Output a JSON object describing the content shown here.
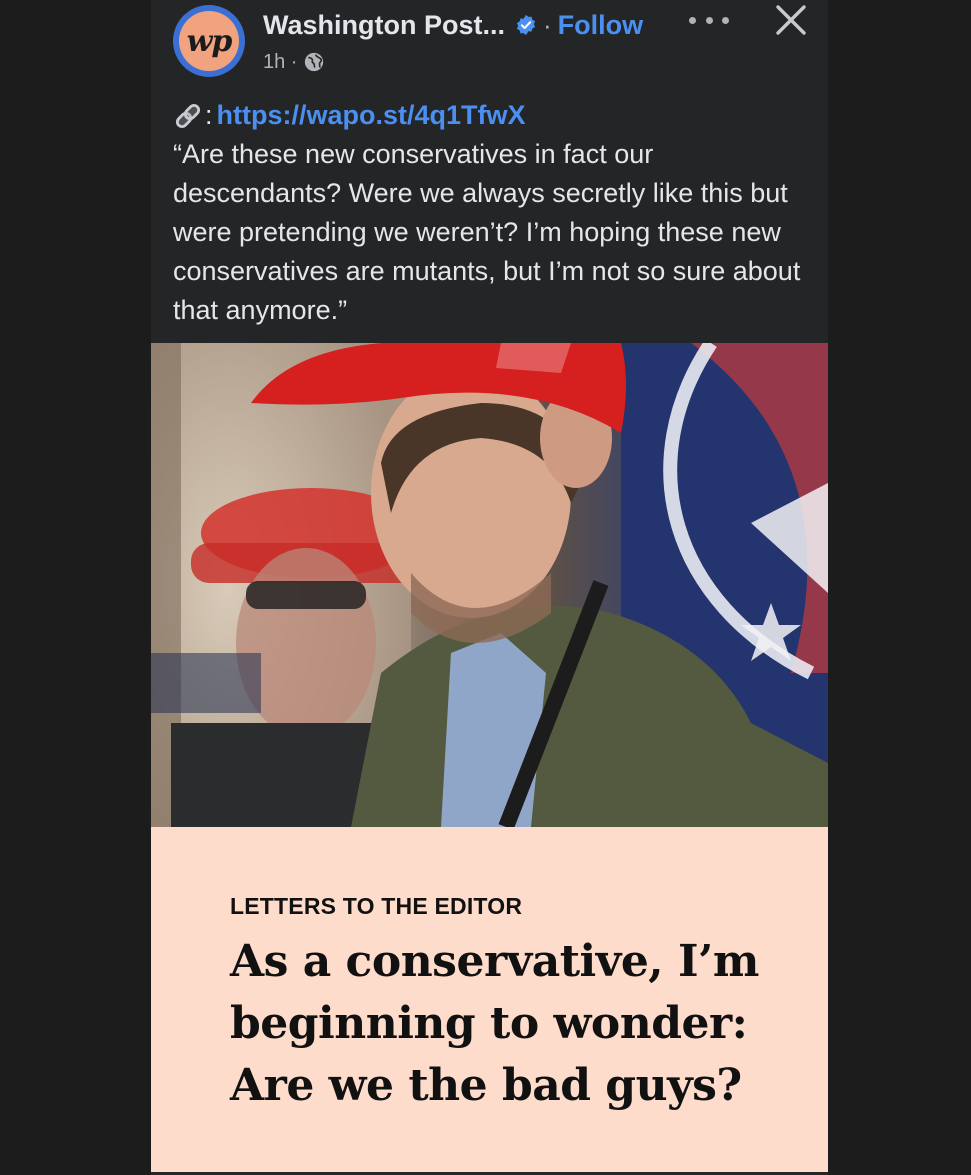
{
  "post": {
    "page_name": "Washington Post...",
    "follow_label": "Follow",
    "separator": "·",
    "time": "1h ·",
    "avatar_text": "wp",
    "link_prefix": ":",
    "link_url": "https://wapo.st/4q1TfwX",
    "body_quote": "“Are these new conservatives in fact our descendants? Were we always secretly like this but were pretending we weren’t? I’m hoping these new conservatives are mutants, but I’m not so sure about that anymore.”"
  },
  "article": {
    "kicker": "LETTERS TO THE EDITOR",
    "headline": "As a conservative, I’m beginning to wonder: Are we the bad guys?"
  },
  "icons": {
    "verified": "verified-badge-icon",
    "globe": "globe-icon",
    "more": "more-options-icon",
    "close": "close-icon",
    "link": "link-icon"
  },
  "colors": {
    "background": "#1c1c1d",
    "post_bg": "#242526",
    "text": "#e4e6eb",
    "secondary_text": "#b0b3b8",
    "link_blue": "#4b8ff0",
    "card_bg": "#fedccc"
  }
}
